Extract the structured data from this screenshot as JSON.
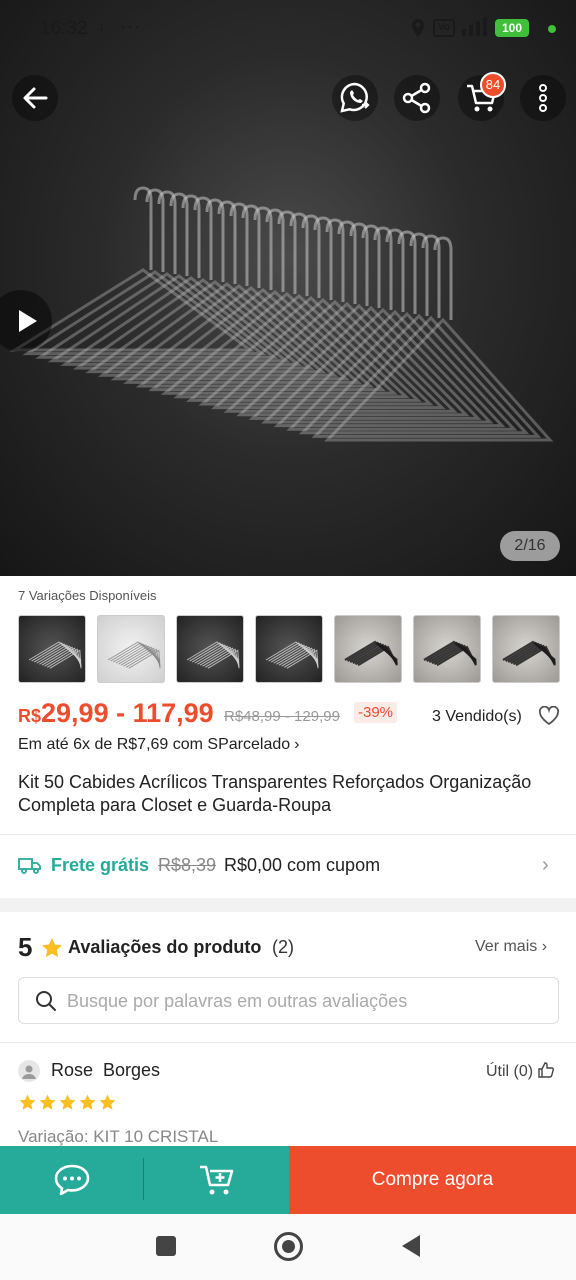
{
  "status_bar": {
    "time": "16:32",
    "download_glyph": "↓",
    "dots": "···",
    "volte": "Vo",
    "battery": "100"
  },
  "header": {
    "cart_badge": "84",
    "icons": [
      "back-arrow-icon",
      "whatsapp-share-icon",
      "share-icon",
      "cart-icon",
      "more-vertical-icon"
    ]
  },
  "gallery": {
    "counter": "2/16"
  },
  "variations": {
    "label": "7 Variações Disponíveis",
    "thumbs": [
      "dark",
      "light",
      "dark",
      "dark",
      "grey",
      "grey",
      "grey"
    ]
  },
  "price": {
    "currency": "R$",
    "range": "29,99 - 117,99",
    "old": "R$48,99 - 129,99",
    "discount": "-39%",
    "sold": "3 Vendido(s)"
  },
  "installments": {
    "text": "Em até 6x de R$7,69 com SParcelado",
    "chevron": "›"
  },
  "product": {
    "title": "Kit 50 Cabides Acrílicos Transparentes Reforçados Organização Completa para Closet e Guarda-Roupa"
  },
  "shipping": {
    "free_label": "Frete grátis",
    "old_price": "R$8,39",
    "new_price": "R$0,00 com cupom",
    "chevron": "›"
  },
  "reviews": {
    "score": "5",
    "title": "Avaliações do produto",
    "count": "(2)",
    "see_more": "Ver mais ›",
    "search_placeholder": "Busque por palavras em outras avaliações",
    "first": {
      "name": "Rose  Borges",
      "helpful": "Útil (0)",
      "rating": 5,
      "variation": "Variação: KIT 10 CRISTAL"
    }
  },
  "actions": {
    "buy_now": "Compre agora"
  },
  "colors": {
    "accent": "#ee4d2d",
    "teal": "#26aa99",
    "star": "#fbbf24"
  }
}
